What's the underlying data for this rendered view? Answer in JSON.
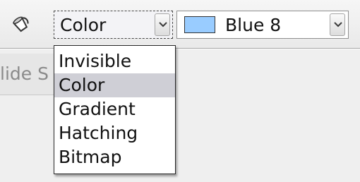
{
  "toolbar": {
    "fill_icon": "paint-bucket-icon",
    "area_style": {
      "value": "Color",
      "options": [
        "Invisible",
        "Color",
        "Gradient",
        "Hatching",
        "Bitmap"
      ],
      "selected_index": 1
    },
    "fill_color": {
      "value": "Blue 8",
      "swatch": "#99ccff"
    }
  },
  "partial_label": "lide S",
  "colors": {
    "selection": "#cfcfd6",
    "toolbar_bg": "#efefef"
  }
}
